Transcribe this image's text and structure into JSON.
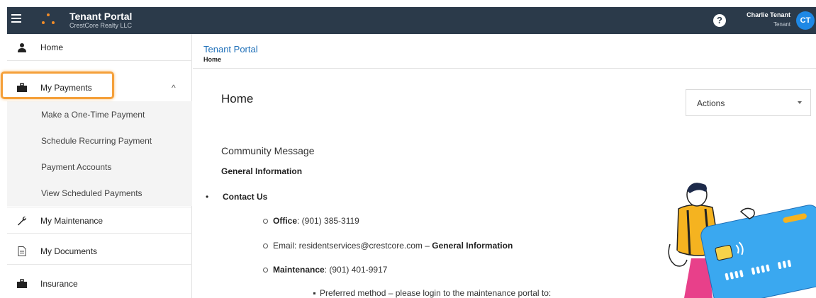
{
  "topbar": {
    "title": "Tenant Portal",
    "subtitle": "CrestCore Realty LLC",
    "help_glyph": "?",
    "user_name": "Charlie Tenant",
    "user_role": "Tenant",
    "user_initials": "CT",
    "icons": [
      "menu-icon",
      "logo-icon",
      "help-icon"
    ]
  },
  "sidebar": {
    "items": [
      {
        "label": "Home",
        "icon": "user-icon"
      },
      {
        "label": "My Payments",
        "icon": "briefcase-icon",
        "expanded": true
      },
      {
        "label": "My Maintenance",
        "icon": "wrench-icon"
      },
      {
        "label": "My Documents",
        "icon": "document-icon"
      },
      {
        "label": "Insurance",
        "icon": "briefcase-icon"
      }
    ],
    "payments_sub": [
      "Make a One-Time Payment",
      "Schedule Recurring Payment",
      "Payment Accounts",
      "View Scheduled Payments"
    ],
    "chevron": "^"
  },
  "breadcrumb": {
    "title": "Tenant Portal",
    "current": "Home"
  },
  "main": {
    "page_title": "Home",
    "actions_label": "Actions",
    "community_title": "Community Message",
    "general_info": "General Information",
    "contact_us": "Contact Us",
    "office_label": "Office",
    "office_value": ": (901) 385-3119",
    "email_text": "Email: residentservices@crestcore.com – ",
    "email_bold": "General Information",
    "maint_label": "Maintenance",
    "maint_value": ": (901) 401-9917",
    "preferred": "Preferred method – please login to the maintenance portal to:"
  },
  "colors": {
    "topbar": "#2b3a4a",
    "accent": "#1e88e5",
    "highlight": "#f5a03a",
    "card": "#3aa8f0"
  }
}
